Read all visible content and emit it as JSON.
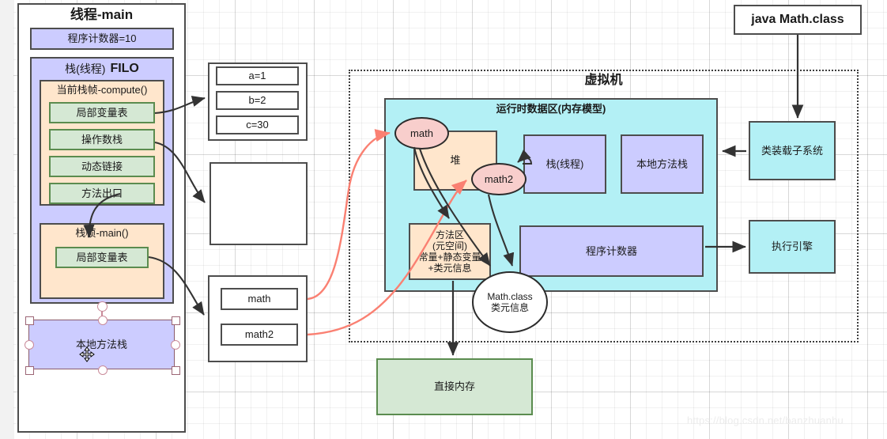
{
  "canvas": {
    "watermark": "https://blog.csdn.net/banzhuanhu"
  },
  "thread_panel": {
    "title": "线程-main",
    "program_counter": "程序计数器=10",
    "stack": {
      "title": "栈(线程)",
      "title_bold": "FILO",
      "frames": [
        {
          "title": "当前栈帧-compute()",
          "items": [
            "局部变量表",
            "操作数栈",
            "动态链接",
            "方法出口"
          ]
        },
        {
          "title": "栈帧-main()",
          "items": [
            "局部变量表"
          ]
        }
      ]
    },
    "native_stack": "本地方法栈"
  },
  "locals_box": {
    "items": [
      "a=1",
      "b=2",
      "c=30"
    ]
  },
  "empty_box": {
    "label": ""
  },
  "refs_box": {
    "items": [
      "math",
      "math2"
    ]
  },
  "vm": {
    "title": "虚拟机",
    "runtime_area": {
      "title": "运行时数据区(内存模型)",
      "heap": "堆",
      "stack": "栈(线程)",
      "native_method_stack": "本地方法栈",
      "method_area": "方法区\n(元空间)\n常量+静态变量\n+类元信息",
      "program_counter": "程序计数器"
    },
    "objects": [
      {
        "label": "math"
      },
      {
        "label": "math2"
      }
    ],
    "class_meta": "Math.class\n类元信息"
  },
  "right_column": {
    "class_file": "java Math.class",
    "class_loader": "类装载子系统",
    "execution_engine": "执行引擎"
  },
  "direct_memory": "直接内存",
  "colors": {
    "purple": "#ccccff",
    "green": "#d5e8d4",
    "orange": "#ffe6cc",
    "cyan": "#b3f0f5",
    "pink": "#f8cecc",
    "arrow_dark": "#333333",
    "arrow_red": "#fa8072",
    "border": "#4d4d4d"
  }
}
